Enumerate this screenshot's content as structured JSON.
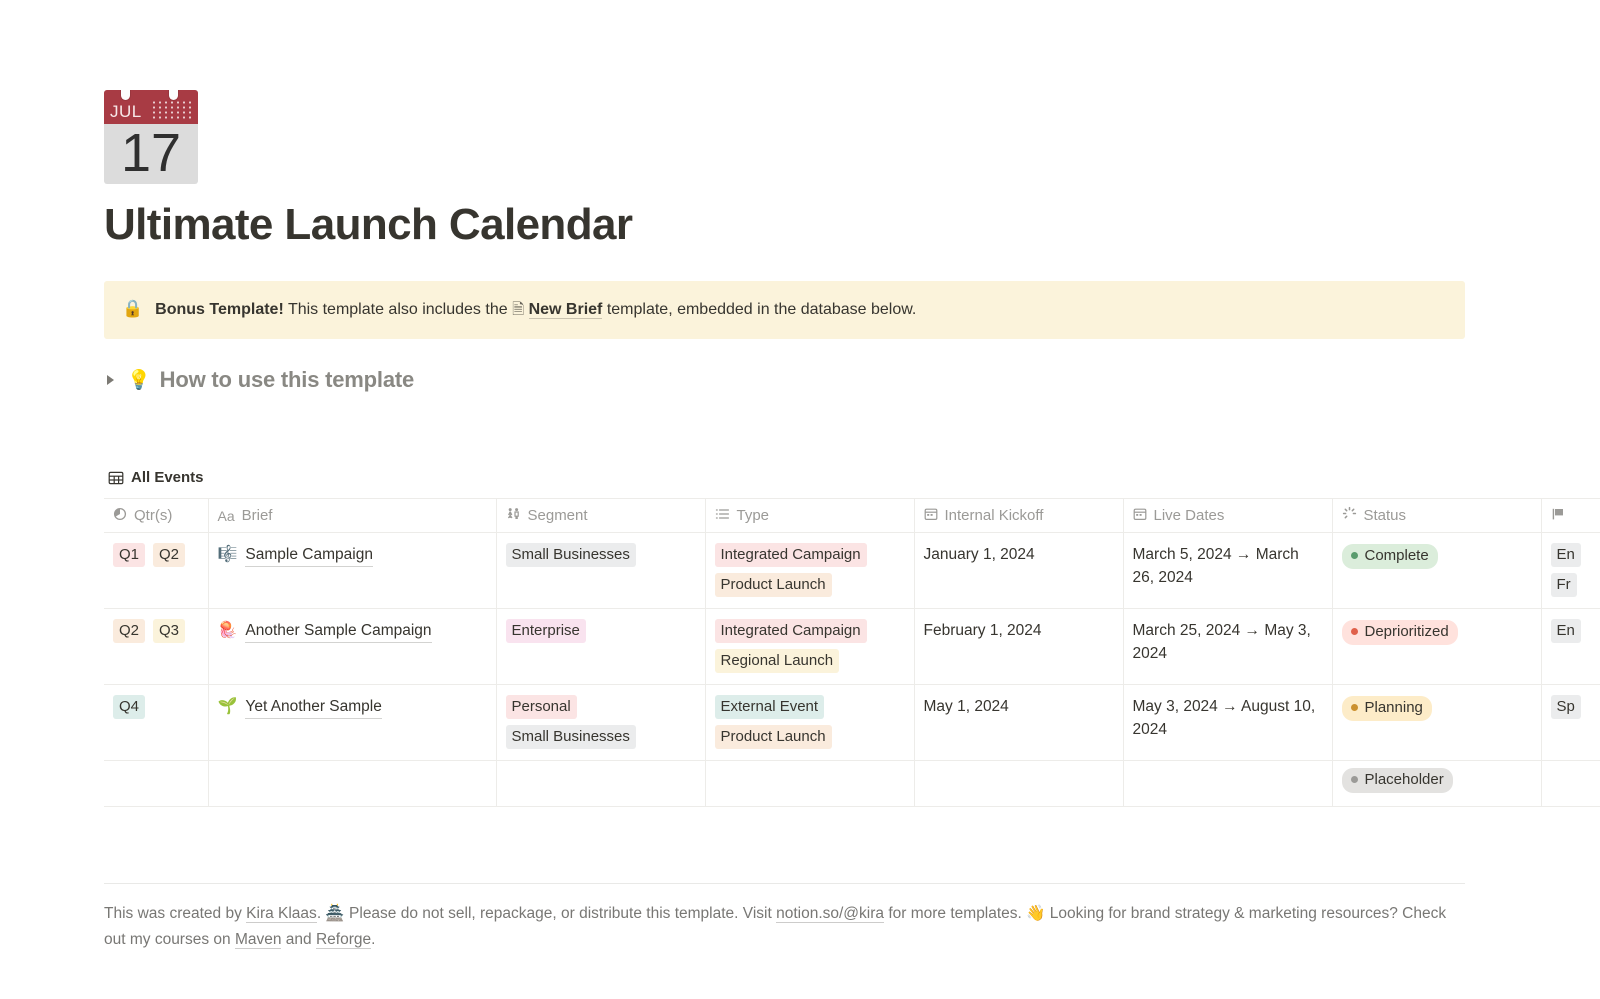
{
  "page": {
    "icon": {
      "month": "JUL",
      "day": "17",
      "name": "calendar-emoji"
    },
    "title": "Ultimate Launch Calendar"
  },
  "callout": {
    "emoji": "🔒",
    "bold_lead": "Bonus Template!",
    "text_before_link": " This template also includes the ",
    "doc_glyph": "🗎",
    "link_text": "New Brief",
    "text_after_link": " template, embedded in the database below."
  },
  "toggle": {
    "emoji": "💡",
    "label": "How to use this template",
    "expanded": false
  },
  "database": {
    "icon": "table-icon",
    "name": "All Events",
    "columns": [
      {
        "key": "qtrs",
        "label": "Qtr(s)",
        "icon": "multi-select-icon"
      },
      {
        "key": "brief",
        "label": "Brief",
        "icon": "title-aa-icon"
      },
      {
        "key": "segment",
        "label": "Segment",
        "icon": "people-icon"
      },
      {
        "key": "type",
        "label": "Type",
        "icon": "list-icon"
      },
      {
        "key": "kickoff",
        "label": "Internal Kickoff",
        "icon": "calendar-icon"
      },
      {
        "key": "live",
        "label": "Live Dates",
        "icon": "calendar-icon"
      },
      {
        "key": "status",
        "label": "Status",
        "icon": "status-spinner-icon"
      },
      {
        "key": "extra",
        "label": "",
        "icon": "flag-icon"
      }
    ],
    "rows": [
      {
        "qtrs": [
          "Q1",
          "Q2"
        ],
        "emoji": "🎼",
        "brief": "Sample Campaign",
        "segment": [
          "Small Businesses"
        ],
        "type": [
          "Integrated Campaign",
          "Product Launch"
        ],
        "kickoff": "January 1, 2024",
        "live": "March 5, 2024 → March 26, 2024",
        "status": "Complete",
        "extra": [
          "En",
          "Fr"
        ]
      },
      {
        "qtrs": [
          "Q2",
          "Q3"
        ],
        "emoji": "🪼",
        "brief": "Another Sample Campaign",
        "segment": [
          "Enterprise"
        ],
        "type": [
          "Integrated Campaign",
          "Regional Launch"
        ],
        "kickoff": "February 1, 2024",
        "live": "March 25, 2024 → May 3, 2024",
        "status": "Deprioritized",
        "extra": [
          "En"
        ]
      },
      {
        "qtrs": [
          "Q4"
        ],
        "emoji": "🌱",
        "brief": "Yet Another Sample",
        "segment": [
          "Personal",
          "Small Businesses"
        ],
        "type": [
          "External Event",
          "Product Launch"
        ],
        "kickoff": "May 1, 2024",
        "live": "May 3, 2024 → August 10, 2024",
        "status": "Planning",
        "extra": [
          "Sp"
        ]
      },
      {
        "qtrs": [],
        "emoji": "",
        "brief": "",
        "segment": [],
        "type": [],
        "kickoff": "",
        "live": "",
        "status": "Placeholder",
        "extra": []
      }
    ]
  },
  "footer": {
    "line1_a": "This was created by ",
    "author_link": "Kira Klaas",
    "line1_b": ". 🏯 Please do not sell, repackage, or distribute this template. Visit ",
    "site_link": "notion.so/@kira",
    "line1_c": " for more templates. 👋 Looking for brand strategy & marketing resources? Check out my courses on ",
    "maven_link": "Maven",
    "line1_d": " and ",
    "reforge_link": "Reforge",
    "line1_e": "."
  },
  "colors": {
    "tag_pink": "#fbe4e4",
    "tag_orange": "#faebdd",
    "tag_yellow": "#fbf3db",
    "tag_green": "#ddedea",
    "tag_gray": "#ebeced",
    "tag_purple_pink": "#f9e3ef",
    "status_complete_bg": "#dbeddb",
    "status_complete_dot": "#5a9c6e",
    "status_deprioritized_bg": "#ffe2dd",
    "status_deprioritized_dot": "#e0604a",
    "status_planning_bg": "#fdecc8",
    "status_planning_dot": "#cb912f",
    "status_placeholder_bg": "#e3e2e0",
    "status_placeholder_dot": "#9b9a97",
    "callout_bg": "#fbf3db",
    "accent_title": "#37352f"
  }
}
